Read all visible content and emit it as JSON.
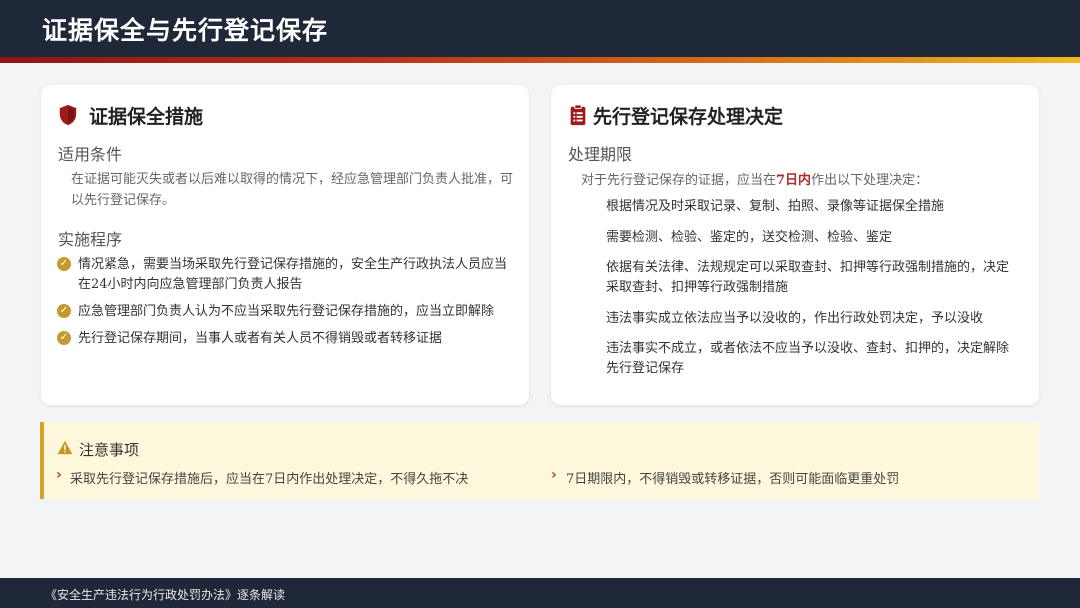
{
  "header": {
    "title": "证据保全与先行登记保存"
  },
  "left_card": {
    "title": "证据保全措施",
    "icon": "shield-icon",
    "conditions_label": "适用条件",
    "conditions_text": "在证据可能灭失或者以后难以取得的情况下，经应急管理部门负责人批准，可以先行登记保存。",
    "procedure_label": "实施程序",
    "procedure_items": [
      "情况紧急，需要当场采取先行登记保存措施的，安全生产行政执法人员应当在24小时内向应急管理部门负责人报告",
      "应急管理部门负责人认为不应当采取先行登记保存措施的，应当立即解除",
      "先行登记保存期间，当事人或者有关人员不得销毁或者转移证据"
    ]
  },
  "right_card": {
    "title": "先行登记保存处理决定",
    "icon": "clipboard-list-icon",
    "period_label": "处理期限",
    "intro_before": "对于先行登记保存的证据，应当在",
    "intro_highlight": "7日内",
    "intro_after": "作出以下处理决定：",
    "items": [
      "根据情况及时采取记录、复制、拍照、录像等证据保全措施",
      "需要检测、检验、鉴定的，送交检测、检验、鉴定",
      "依据有关法律、法规规定可以采取查封、扣押等行政强制措施的，决定采取查封、扣押等行政强制措施",
      "违法事实成立依法应当予以没收的，作出行政处罚决定，予以没收",
      "违法事实不成立，或者依法不应当予以没收、查封、扣押的，决定解除先行登记保存"
    ]
  },
  "notice": {
    "title": "注意事项",
    "icon": "warning-icon",
    "items": [
      "采取先行登记保存措施后，应当在7日内作出处理决定，不得久拖不决",
      "7日期限内，不得销毁或转移证据，否则可能面临更重处罚"
    ]
  },
  "footer": {
    "text": "《安全生产违法行为行政处罚办法》逐条解读"
  },
  "colors": {
    "header_bg": "#1e2838",
    "accent_red": "#a01c1c",
    "accent_gold": "#c39a2e",
    "notice_bg": "#fdf8dc"
  }
}
